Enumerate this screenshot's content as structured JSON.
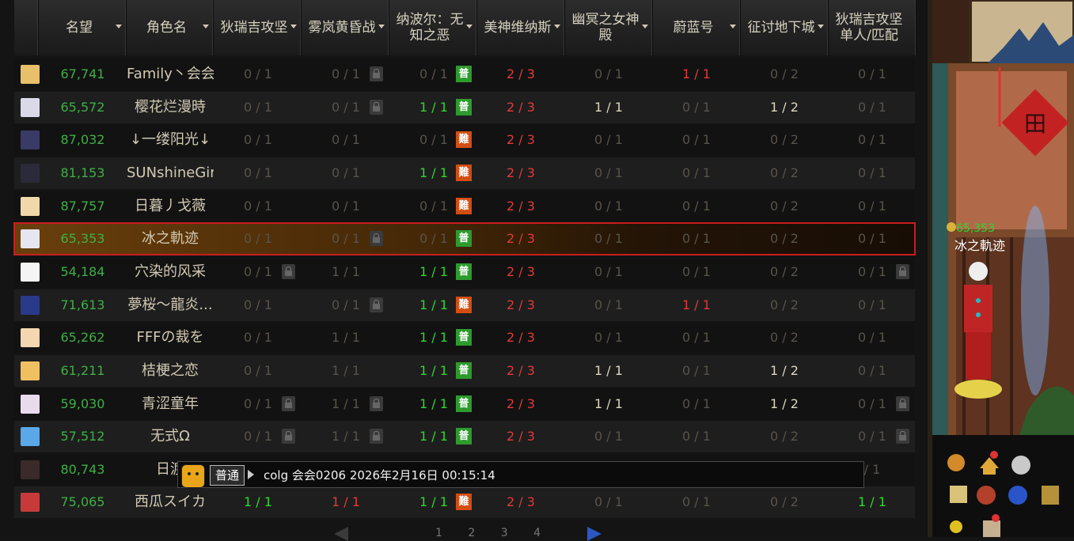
{
  "columns": [
    {
      "key": "fame",
      "label": "名望",
      "dropdown": true
    },
    {
      "key": "name",
      "label": "角色名",
      "dropdown": true
    },
    {
      "key": "d1",
      "label": "狄瑞吉攻坚",
      "dropdown": true
    },
    {
      "key": "d2",
      "label": "雾岚黄昏战",
      "dropdown": true
    },
    {
      "key": "d3",
      "label": "纳波尔：无知之恶",
      "dropdown": true
    },
    {
      "key": "d4",
      "label": "美神维纳斯",
      "dropdown": true
    },
    {
      "key": "d5",
      "label": "幽冥之女神殿",
      "dropdown": true
    },
    {
      "key": "d6",
      "label": "蔚蓝号",
      "dropdown": true
    },
    {
      "key": "d7",
      "label": "征讨地下城",
      "dropdown": true
    },
    {
      "key": "d8",
      "label": "狄瑞吉攻坚单人/匹配",
      "dropdown": false
    }
  ],
  "colors": {
    "green": "#2fd62f",
    "red": "#e03a3a",
    "gray": "#58534a",
    "white": "#ddd6c0",
    "selected_outline": "#c81e1e"
  },
  "rows": [
    {
      "fame": "67,741",
      "name": "Family丶会会",
      "selected": false,
      "cells": [
        {
          "t": "0 / 1",
          "c": "g0"
        },
        {
          "t": "0 / 1",
          "c": "g0",
          "lock": true
        },
        {
          "t": "0 / 1",
          "c": "g0",
          "tag": "普"
        },
        {
          "t": "2 / 3",
          "c": "gr"
        },
        {
          "t": "0 / 1",
          "c": "g0"
        },
        {
          "t": "1 / 1",
          "c": "gr"
        },
        {
          "t": "0 / 2",
          "c": "g0"
        },
        {
          "t": "0 / 1",
          "c": "g0"
        }
      ]
    },
    {
      "fame": "65,572",
      "name": "樱花烂漫時",
      "selected": false,
      "cells": [
        {
          "t": "0 / 1",
          "c": "g0"
        },
        {
          "t": "0 / 1",
          "c": "g0",
          "lock": true
        },
        {
          "t": "1 / 1",
          "c": "gg",
          "tag": "普"
        },
        {
          "t": "2 / 3",
          "c": "gr"
        },
        {
          "t": "1 / 1",
          "c": "gw"
        },
        {
          "t": "0 / 1",
          "c": "g0"
        },
        {
          "t": "1 / 2",
          "c": "gw"
        },
        {
          "t": "0 / 1",
          "c": "g0"
        }
      ]
    },
    {
      "fame": "87,032",
      "name": "↓一缕阳光↓",
      "selected": false,
      "cells": [
        {
          "t": "0 / 1",
          "c": "g0"
        },
        {
          "t": "0 / 1",
          "c": "g0"
        },
        {
          "t": "0 / 1",
          "c": "g0",
          "tag": "難"
        },
        {
          "t": "2 / 3",
          "c": "gr"
        },
        {
          "t": "0 / 1",
          "c": "g0"
        },
        {
          "t": "0 / 1",
          "c": "g0"
        },
        {
          "t": "0 / 2",
          "c": "g0"
        },
        {
          "t": "0 / 1",
          "c": "g0"
        }
      ]
    },
    {
      "fame": "81,153",
      "name": "SUNshineGir",
      "selected": false,
      "cells": [
        {
          "t": "0 / 1",
          "c": "g0"
        },
        {
          "t": "0 / 1",
          "c": "g0"
        },
        {
          "t": "1 / 1",
          "c": "gg",
          "tag": "難"
        },
        {
          "t": "2 / 3",
          "c": "gr"
        },
        {
          "t": "0 / 1",
          "c": "g0"
        },
        {
          "t": "0 / 1",
          "c": "g0"
        },
        {
          "t": "0 / 2",
          "c": "g0"
        },
        {
          "t": "0 / 1",
          "c": "g0"
        }
      ]
    },
    {
      "fame": "87,757",
      "name": "日暮丿戈薇",
      "selected": false,
      "cells": [
        {
          "t": "0 / 1",
          "c": "g0"
        },
        {
          "t": "0 / 1",
          "c": "g0"
        },
        {
          "t": "0 / 1",
          "c": "g0",
          "tag": "難"
        },
        {
          "t": "2 / 3",
          "c": "gr"
        },
        {
          "t": "0 / 1",
          "c": "g0"
        },
        {
          "t": "0 / 1",
          "c": "g0"
        },
        {
          "t": "0 / 2",
          "c": "g0"
        },
        {
          "t": "0 / 1",
          "c": "g0"
        }
      ]
    },
    {
      "fame": "65,353",
      "name": "冰之軌迹",
      "selected": true,
      "cells": [
        {
          "t": "0 / 1",
          "c": "g0"
        },
        {
          "t": "0 / 1",
          "c": "g0",
          "lock": true
        },
        {
          "t": "0 / 1",
          "c": "g0",
          "tag": "普"
        },
        {
          "t": "2 / 3",
          "c": "gr"
        },
        {
          "t": "0 / 1",
          "c": "g0"
        },
        {
          "t": "0 / 1",
          "c": "g0"
        },
        {
          "t": "0 / 2",
          "c": "g0"
        },
        {
          "t": "0 / 1",
          "c": "g0"
        }
      ]
    },
    {
      "fame": "54,184",
      "name": "穴染的风采",
      "selected": false,
      "cells": [
        {
          "t": "0 / 1",
          "c": "g0",
          "lock": true
        },
        {
          "t": "1 / 1",
          "c": "g0"
        },
        {
          "t": "1 / 1",
          "c": "gg",
          "tag": "普"
        },
        {
          "t": "2 / 3",
          "c": "gr"
        },
        {
          "t": "0 / 1",
          "c": "g0"
        },
        {
          "t": "0 / 1",
          "c": "g0"
        },
        {
          "t": "0 / 2",
          "c": "g0"
        },
        {
          "t": "0 / 1",
          "c": "g0",
          "lock": true
        }
      ]
    },
    {
      "fame": "71,613",
      "name": "夢桜～龍炎...",
      "selected": false,
      "cells": [
        {
          "t": "0 / 1",
          "c": "g0"
        },
        {
          "t": "0 / 1",
          "c": "g0",
          "lock": true
        },
        {
          "t": "1 / 1",
          "c": "gg",
          "tag": "難"
        },
        {
          "t": "2 / 3",
          "c": "gr"
        },
        {
          "t": "0 / 1",
          "c": "g0"
        },
        {
          "t": "1 / 1",
          "c": "gr"
        },
        {
          "t": "0 / 2",
          "c": "g0"
        },
        {
          "t": "0 / 1",
          "c": "g0"
        }
      ]
    },
    {
      "fame": "65,262",
      "name": "FFFの裁を",
      "selected": false,
      "cells": [
        {
          "t": "0 / 1",
          "c": "g0"
        },
        {
          "t": "1 / 1",
          "c": "g0"
        },
        {
          "t": "1 / 1",
          "c": "gg",
          "tag": "普"
        },
        {
          "t": "2 / 3",
          "c": "gr"
        },
        {
          "t": "0 / 1",
          "c": "g0"
        },
        {
          "t": "0 / 1",
          "c": "g0"
        },
        {
          "t": "0 / 2",
          "c": "g0"
        },
        {
          "t": "0 / 1",
          "c": "g0"
        }
      ]
    },
    {
      "fame": "61,211",
      "name": "桔梗之恋",
      "selected": false,
      "cells": [
        {
          "t": "0 / 1",
          "c": "g0"
        },
        {
          "t": "1 / 1",
          "c": "g0"
        },
        {
          "t": "1 / 1",
          "c": "gg",
          "tag": "普"
        },
        {
          "t": "2 / 3",
          "c": "gr"
        },
        {
          "t": "1 / 1",
          "c": "gw"
        },
        {
          "t": "0 / 1",
          "c": "g0"
        },
        {
          "t": "1 / 2",
          "c": "gw"
        },
        {
          "t": "0 / 1",
          "c": "g0"
        }
      ]
    },
    {
      "fame": "59,030",
      "name": "青涩童年",
      "selected": false,
      "cells": [
        {
          "t": "0 / 1",
          "c": "g0",
          "lock": true
        },
        {
          "t": "1 / 1",
          "c": "g0",
          "lock": true
        },
        {
          "t": "1 / 1",
          "c": "gg",
          "tag": "普"
        },
        {
          "t": "2 / 3",
          "c": "gr"
        },
        {
          "t": "1 / 1",
          "c": "gw"
        },
        {
          "t": "0 / 1",
          "c": "g0"
        },
        {
          "t": "1 / 2",
          "c": "gw"
        },
        {
          "t": "0 / 1",
          "c": "g0",
          "lock": true
        }
      ]
    },
    {
      "fame": "57,512",
      "name": "无式Ω",
      "selected": false,
      "cells": [
        {
          "t": "0 / 1",
          "c": "g0",
          "lock": true
        },
        {
          "t": "1 / 1",
          "c": "g0",
          "lock": true
        },
        {
          "t": "1 / 1",
          "c": "gg",
          "tag": "普"
        },
        {
          "t": "2 / 3",
          "c": "gr"
        },
        {
          "t": "0 / 1",
          "c": "g0"
        },
        {
          "t": "0 / 1",
          "c": "g0"
        },
        {
          "t": "0 / 2",
          "c": "g0"
        },
        {
          "t": "0 / 1",
          "c": "g0",
          "lock": true
        }
      ]
    },
    {
      "fame": "80,743",
      "name": "日渡",
      "selected": false,
      "cells": [
        {
          "t": "",
          "c": "g0"
        },
        {
          "t": "",
          "c": "g0"
        },
        {
          "t": "",
          "c": "g0"
        },
        {
          "t": "",
          "c": "g0"
        },
        {
          "t": "",
          "c": "g0"
        },
        {
          "t": "",
          "c": "g0"
        },
        {
          "t": "",
          "c": "g0"
        },
        {
          "t": "/ 1",
          "c": "g0"
        }
      ]
    },
    {
      "fame": "75,065",
      "name": "西瓜スイカ",
      "selected": false,
      "cells": [
        {
          "t": "1 / 1",
          "c": "gg"
        },
        {
          "t": "1 / 1",
          "c": "gr"
        },
        {
          "t": "1 / 1",
          "c": "gg",
          "tag": "難"
        },
        {
          "t": "2 / 3",
          "c": "gr"
        },
        {
          "t": "0 / 1",
          "c": "g0"
        },
        {
          "t": "0 / 1",
          "c": "g0"
        },
        {
          "t": "0 / 2",
          "c": "g0"
        },
        {
          "t": "1 / 1",
          "c": "gg"
        }
      ]
    }
  ],
  "chat": {
    "channel": "普通",
    "message": "colg 会会0206 2026年2月16日 00:15:14",
    "emoji": "face-emoji"
  },
  "pager": {
    "numbers": "1 2 3 4"
  },
  "scene": {
    "player_fame": "65,353",
    "player_name": "冰之軌迹",
    "window_char": "田"
  }
}
